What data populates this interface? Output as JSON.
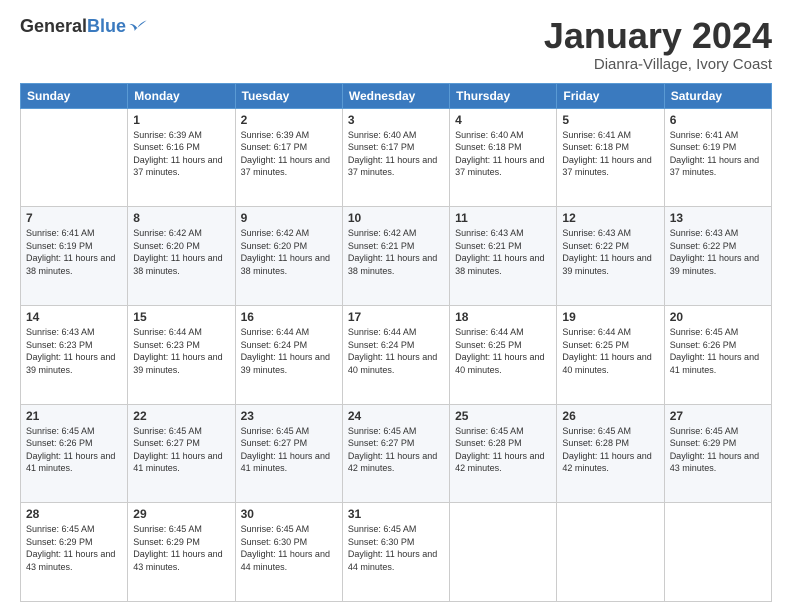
{
  "logo": {
    "general": "General",
    "blue": "Blue"
  },
  "header": {
    "title": "January 2024",
    "location": "Dianra-Village, Ivory Coast"
  },
  "days_of_week": [
    "Sunday",
    "Monday",
    "Tuesday",
    "Wednesday",
    "Thursday",
    "Friday",
    "Saturday"
  ],
  "weeks": [
    [
      {
        "day": "",
        "sunrise": "",
        "sunset": "",
        "daylight": ""
      },
      {
        "day": "1",
        "sunrise": "Sunrise: 6:39 AM",
        "sunset": "Sunset: 6:16 PM",
        "daylight": "Daylight: 11 hours and 37 minutes."
      },
      {
        "day": "2",
        "sunrise": "Sunrise: 6:39 AM",
        "sunset": "Sunset: 6:17 PM",
        "daylight": "Daylight: 11 hours and 37 minutes."
      },
      {
        "day": "3",
        "sunrise": "Sunrise: 6:40 AM",
        "sunset": "Sunset: 6:17 PM",
        "daylight": "Daylight: 11 hours and 37 minutes."
      },
      {
        "day": "4",
        "sunrise": "Sunrise: 6:40 AM",
        "sunset": "Sunset: 6:18 PM",
        "daylight": "Daylight: 11 hours and 37 minutes."
      },
      {
        "day": "5",
        "sunrise": "Sunrise: 6:41 AM",
        "sunset": "Sunset: 6:18 PM",
        "daylight": "Daylight: 11 hours and 37 minutes."
      },
      {
        "day": "6",
        "sunrise": "Sunrise: 6:41 AM",
        "sunset": "Sunset: 6:19 PM",
        "daylight": "Daylight: 11 hours and 37 minutes."
      }
    ],
    [
      {
        "day": "7",
        "sunrise": "Sunrise: 6:41 AM",
        "sunset": "Sunset: 6:19 PM",
        "daylight": "Daylight: 11 hours and 38 minutes."
      },
      {
        "day": "8",
        "sunrise": "Sunrise: 6:42 AM",
        "sunset": "Sunset: 6:20 PM",
        "daylight": "Daylight: 11 hours and 38 minutes."
      },
      {
        "day": "9",
        "sunrise": "Sunrise: 6:42 AM",
        "sunset": "Sunset: 6:20 PM",
        "daylight": "Daylight: 11 hours and 38 minutes."
      },
      {
        "day": "10",
        "sunrise": "Sunrise: 6:42 AM",
        "sunset": "Sunset: 6:21 PM",
        "daylight": "Daylight: 11 hours and 38 minutes."
      },
      {
        "day": "11",
        "sunrise": "Sunrise: 6:43 AM",
        "sunset": "Sunset: 6:21 PM",
        "daylight": "Daylight: 11 hours and 38 minutes."
      },
      {
        "day": "12",
        "sunrise": "Sunrise: 6:43 AM",
        "sunset": "Sunset: 6:22 PM",
        "daylight": "Daylight: 11 hours and 39 minutes."
      },
      {
        "day": "13",
        "sunrise": "Sunrise: 6:43 AM",
        "sunset": "Sunset: 6:22 PM",
        "daylight": "Daylight: 11 hours and 39 minutes."
      }
    ],
    [
      {
        "day": "14",
        "sunrise": "Sunrise: 6:43 AM",
        "sunset": "Sunset: 6:23 PM",
        "daylight": "Daylight: 11 hours and 39 minutes."
      },
      {
        "day": "15",
        "sunrise": "Sunrise: 6:44 AM",
        "sunset": "Sunset: 6:23 PM",
        "daylight": "Daylight: 11 hours and 39 minutes."
      },
      {
        "day": "16",
        "sunrise": "Sunrise: 6:44 AM",
        "sunset": "Sunset: 6:24 PM",
        "daylight": "Daylight: 11 hours and 39 minutes."
      },
      {
        "day": "17",
        "sunrise": "Sunrise: 6:44 AM",
        "sunset": "Sunset: 6:24 PM",
        "daylight": "Daylight: 11 hours and 40 minutes."
      },
      {
        "day": "18",
        "sunrise": "Sunrise: 6:44 AM",
        "sunset": "Sunset: 6:25 PM",
        "daylight": "Daylight: 11 hours and 40 minutes."
      },
      {
        "day": "19",
        "sunrise": "Sunrise: 6:44 AM",
        "sunset": "Sunset: 6:25 PM",
        "daylight": "Daylight: 11 hours and 40 minutes."
      },
      {
        "day": "20",
        "sunrise": "Sunrise: 6:45 AM",
        "sunset": "Sunset: 6:26 PM",
        "daylight": "Daylight: 11 hours and 41 minutes."
      }
    ],
    [
      {
        "day": "21",
        "sunrise": "Sunrise: 6:45 AM",
        "sunset": "Sunset: 6:26 PM",
        "daylight": "Daylight: 11 hours and 41 minutes."
      },
      {
        "day": "22",
        "sunrise": "Sunrise: 6:45 AM",
        "sunset": "Sunset: 6:27 PM",
        "daylight": "Daylight: 11 hours and 41 minutes."
      },
      {
        "day": "23",
        "sunrise": "Sunrise: 6:45 AM",
        "sunset": "Sunset: 6:27 PM",
        "daylight": "Daylight: 11 hours and 41 minutes."
      },
      {
        "day": "24",
        "sunrise": "Sunrise: 6:45 AM",
        "sunset": "Sunset: 6:27 PM",
        "daylight": "Daylight: 11 hours and 42 minutes."
      },
      {
        "day": "25",
        "sunrise": "Sunrise: 6:45 AM",
        "sunset": "Sunset: 6:28 PM",
        "daylight": "Daylight: 11 hours and 42 minutes."
      },
      {
        "day": "26",
        "sunrise": "Sunrise: 6:45 AM",
        "sunset": "Sunset: 6:28 PM",
        "daylight": "Daylight: 11 hours and 42 minutes."
      },
      {
        "day": "27",
        "sunrise": "Sunrise: 6:45 AM",
        "sunset": "Sunset: 6:29 PM",
        "daylight": "Daylight: 11 hours and 43 minutes."
      }
    ],
    [
      {
        "day": "28",
        "sunrise": "Sunrise: 6:45 AM",
        "sunset": "Sunset: 6:29 PM",
        "daylight": "Daylight: 11 hours and 43 minutes."
      },
      {
        "day": "29",
        "sunrise": "Sunrise: 6:45 AM",
        "sunset": "Sunset: 6:29 PM",
        "daylight": "Daylight: 11 hours and 43 minutes."
      },
      {
        "day": "30",
        "sunrise": "Sunrise: 6:45 AM",
        "sunset": "Sunset: 6:30 PM",
        "daylight": "Daylight: 11 hours and 44 minutes."
      },
      {
        "day": "31",
        "sunrise": "Sunrise: 6:45 AM",
        "sunset": "Sunset: 6:30 PM",
        "daylight": "Daylight: 11 hours and 44 minutes."
      },
      {
        "day": "",
        "sunrise": "",
        "sunset": "",
        "daylight": ""
      },
      {
        "day": "",
        "sunrise": "",
        "sunset": "",
        "daylight": ""
      },
      {
        "day": "",
        "sunrise": "",
        "sunset": "",
        "daylight": ""
      }
    ]
  ]
}
